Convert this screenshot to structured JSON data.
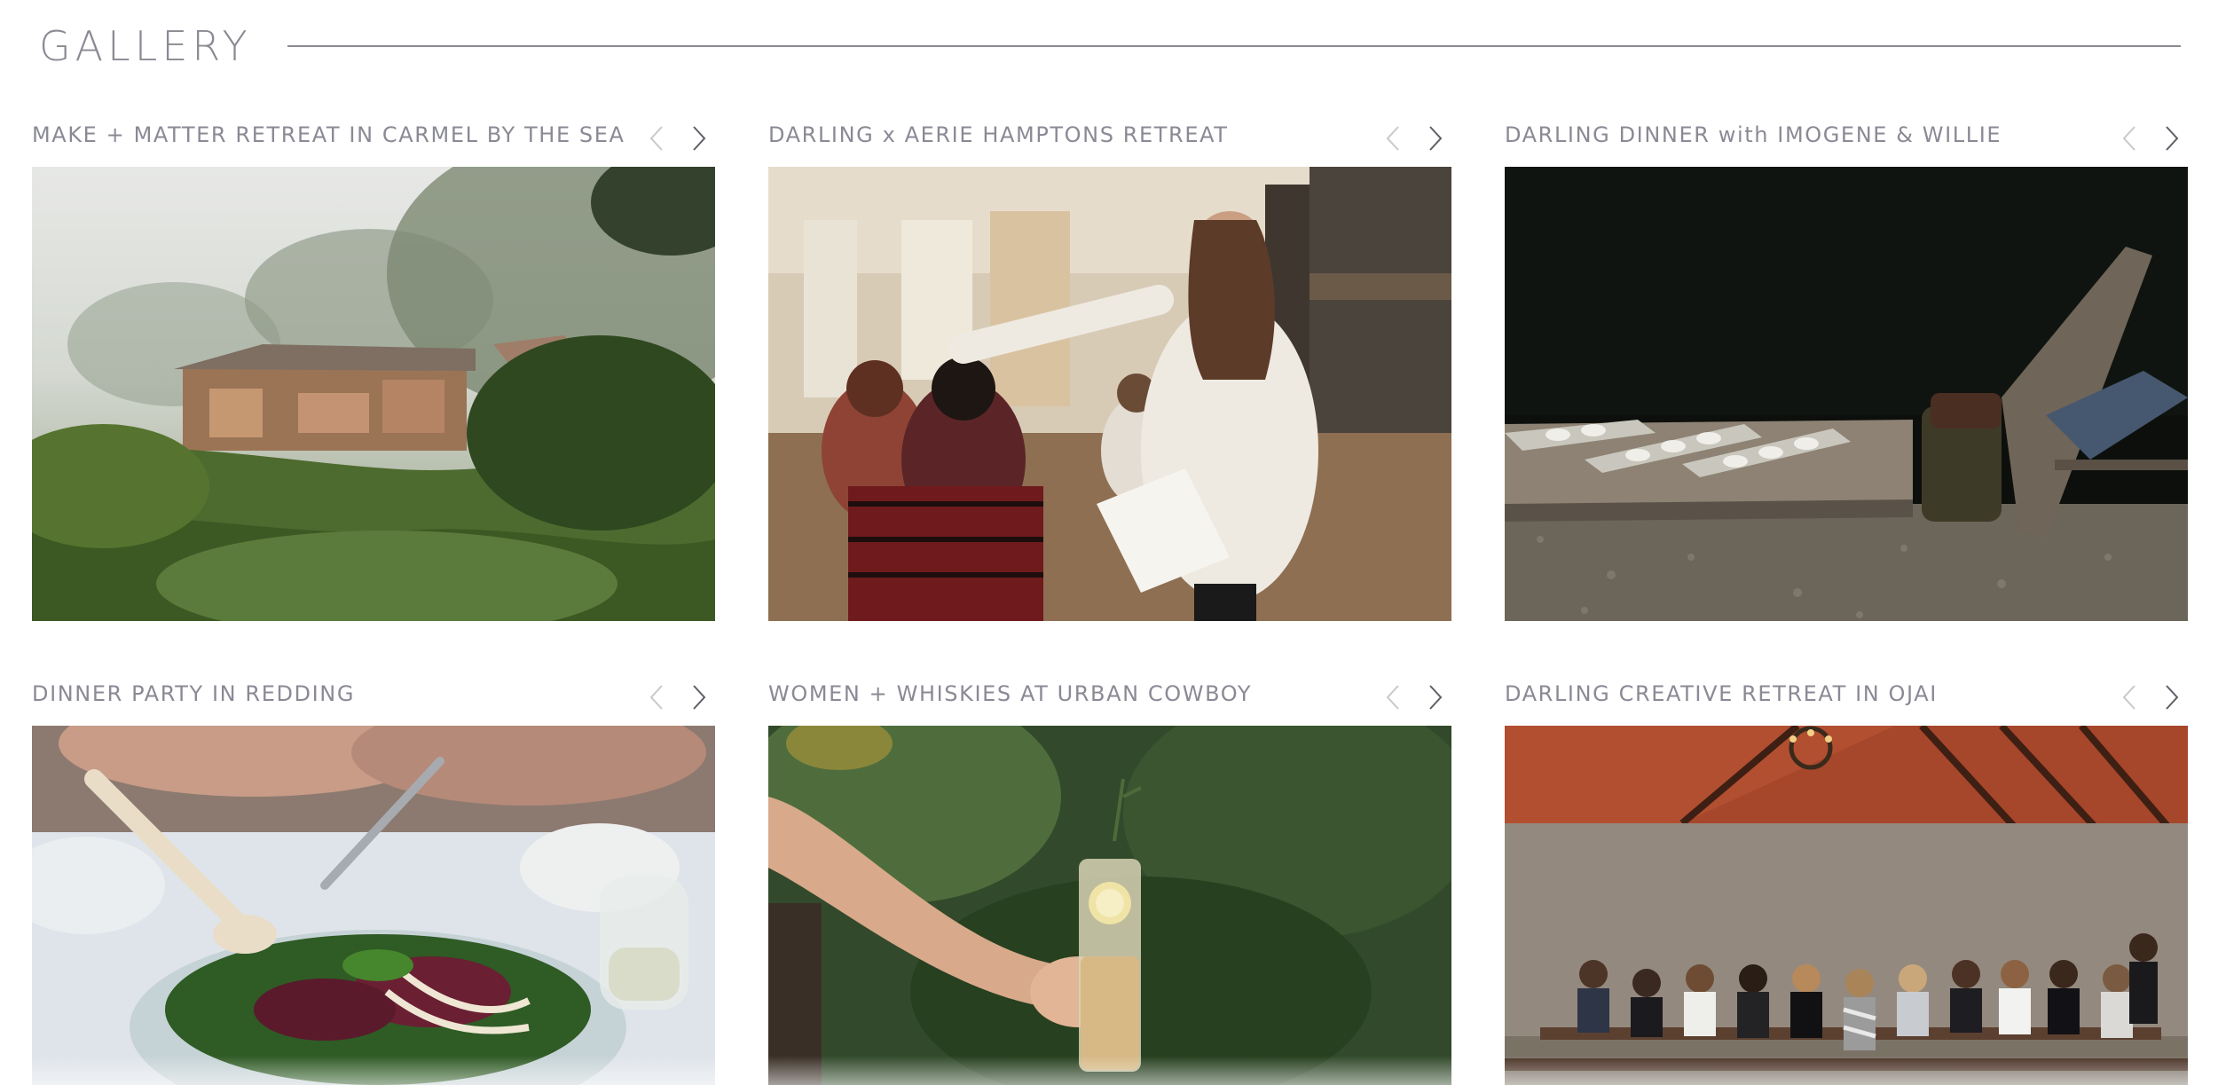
{
  "gallery": {
    "title": "GALLERY",
    "items": [
      {
        "title": "MAKE + MATTER RETREAT IN CARMEL BY THE SEA",
        "photo": "foggy-cliffside-house",
        "prev_icon": "chevron-left-icon",
        "next_icon": "chevron-right-icon"
      },
      {
        "title": "DARLING x AERIE HAMPTONS RETREAT",
        "photo": "woman-presenting-in-living-room",
        "prev_icon": "chevron-left-icon",
        "next_icon": "chevron-right-icon"
      },
      {
        "title": "DARLING DINNER with IMOGENE & WILLIE",
        "photo": "oyster-platters-on-wooden-table",
        "prev_icon": "chevron-left-icon",
        "next_icon": "chevron-right-icon"
      },
      {
        "title": "DINNER PARTY IN REDDING",
        "photo": "beet-salad-with-serving-utensils",
        "prev_icon": "chevron-left-icon",
        "next_icon": "chevron-right-icon"
      },
      {
        "title": "WOMEN + WHISKIES AT URBAN COWBOY",
        "photo": "hand-holding-lemon-cocktail",
        "prev_icon": "chevron-left-icon",
        "next_icon": "chevron-right-icon"
      },
      {
        "title": "DARLING CREATIVE RETREAT IN OJAI",
        "photo": "women-at-long-dinner-table-in-barn",
        "prev_icon": "chevron-left-icon",
        "next_icon": "chevron-right-icon"
      }
    ]
  },
  "colors": {
    "heading": "#8a8a93",
    "card_title": "#8a8a96",
    "arrow_inactive": "#c8c8ce",
    "arrow_active": "#5e5e66",
    "background": "#ffffff"
  }
}
